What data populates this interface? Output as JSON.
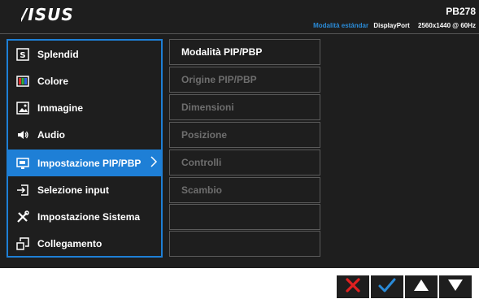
{
  "header": {
    "brand": "/ISUS",
    "model": "PB278",
    "status": {
      "mode": "Modalità estándar",
      "port": "DisplayPort",
      "resolution": "2560x1440 @ 60Hz"
    }
  },
  "main_menu": {
    "items": [
      {
        "label": "Splendid",
        "icon": "splendid-icon"
      },
      {
        "label": "Colore",
        "icon": "color-icon"
      },
      {
        "label": "Immagine",
        "icon": "image-icon"
      },
      {
        "label": "Audio",
        "icon": "speaker-icon"
      },
      {
        "label": "Impostazione PIP/PBP",
        "icon": "pip-icon",
        "selected": true
      },
      {
        "label": "Selezione input",
        "icon": "input-icon"
      },
      {
        "label": "Impostazione Sistema",
        "icon": "tools-icon"
      },
      {
        "label": "Collegamento",
        "icon": "shortcut-icon"
      }
    ]
  },
  "sub_menu": {
    "items": [
      {
        "label": "Modalità PIP/PBP",
        "active": true
      },
      {
        "label": "Origine PIP/PBP",
        "active": false
      },
      {
        "label": "Dimensioni",
        "active": false
      },
      {
        "label": "Posizione",
        "active": false
      },
      {
        "label": "Controlli",
        "active": false
      },
      {
        "label": "Scambio",
        "active": false
      },
      {
        "label": "",
        "active": false
      },
      {
        "label": "",
        "active": false
      }
    ]
  },
  "controls": [
    "close-icon",
    "check-icon",
    "up-arrow-icon",
    "down-arrow-icon"
  ],
  "colors": {
    "accent": "#1e7fd6",
    "status_mode": "#2a8bd8",
    "close": "#e02020",
    "check": "#2a8bd8"
  }
}
